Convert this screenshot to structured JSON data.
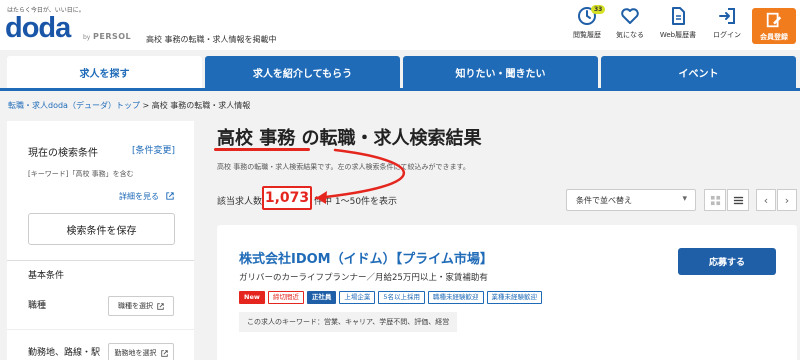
{
  "header": {
    "tagline": "はたらく今日が、いい日に。",
    "logo": "doda",
    "logo_by": "by",
    "logo_persol": "PERSOL",
    "description": "高校 事務の転職・求人情報を掲載中",
    "nav": [
      {
        "label": "閲覧履歴",
        "icon": "clock-icon",
        "badge": "33"
      },
      {
        "label": "気になる",
        "icon": "heart-icon"
      },
      {
        "label": "Web履歴書",
        "icon": "document-icon"
      },
      {
        "label": "ログイン",
        "icon": "login-icon"
      }
    ],
    "register_label": "会員登録",
    "register_color": "#f07c1e"
  },
  "tabs": [
    {
      "label": "求人を探す",
      "active": true
    },
    {
      "label": "求人を紹介してもらう",
      "active": false
    },
    {
      "label": "知りたい・聞きたい",
      "active": false
    },
    {
      "label": "イベント",
      "active": false
    }
  ],
  "breadcrumb": {
    "link": "転職・求人doda（デューダ）トップ",
    "separator": ">",
    "current": "高校 事務の転職・求人情報"
  },
  "sidebar": {
    "title": "現在の検索条件",
    "change_link": "[条件変更]",
    "condition": "[キーワード]「高校 事務」を含む",
    "detail_link": "詳細を見る",
    "save_button": "検索条件を保存",
    "section_title": "基本条件",
    "rows": [
      {
        "label": "職種",
        "button": "職種を選択"
      },
      {
        "label": "勤務地、路線・駅",
        "button": "勤務地を選択"
      }
    ]
  },
  "main": {
    "title": "高校 事務 の転職・求人検索結果",
    "lead": "高校 事務の転職・求人検索結果です。左の求人検索条件にて絞込みができます。",
    "count_label": "該当求人数",
    "count_value": "1,073",
    "range_text": "件中 1～50件を表示",
    "sort_label": "条件で並べ替え",
    "accent_color": "#e4261e"
  },
  "job": {
    "company": "株式会社IDOM（イドム）【プライム市場】",
    "subtitle": "ガリバーのカーライフプランナー／月給25万円以上・家賃補助有",
    "apply_label": "応募する",
    "tags": [
      {
        "label": "New",
        "style": "new"
      },
      {
        "label": "締切間近",
        "style": "red"
      },
      {
        "label": "正社員",
        "style": "blue"
      },
      {
        "label": "上場企業",
        "style": "outline"
      },
      {
        "label": "5名以上採用",
        "style": "outline"
      },
      {
        "label": "職種未経験歓迎",
        "style": "outline"
      },
      {
        "label": "業種未経験歓迎",
        "style": "outline"
      }
    ],
    "keywords": "この求人のキーワード：営業、キャリア、学歴不問、評価、経営"
  }
}
